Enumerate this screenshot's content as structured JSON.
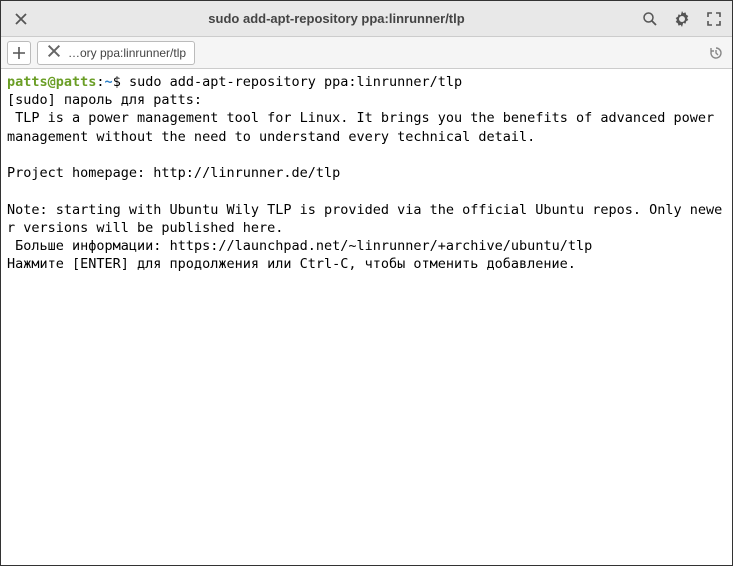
{
  "titlebar": {
    "title": "sudo add-apt-repository ppa:linrunner/tlp"
  },
  "tabbar": {
    "tab_label": "…ory ppa:linrunner/tlp"
  },
  "terminal": {
    "prompt_user": "patts@patts",
    "prompt_sep1": ":",
    "prompt_path": "~",
    "prompt_sep2": "$ ",
    "command": "sudo add-apt-repository ppa:linrunner/tlp",
    "line2": "[sudo] пароль для patts:",
    "line3": " TLP is a power management tool for Linux. It brings you the benefits of advanced power management without the need to understand every technical detail.",
    "line4": "",
    "line5": "Project homepage: http://linrunner.de/tlp",
    "line6": "",
    "line7": "Note: starting with Ubuntu Wily TLP is provided via the official Ubuntu repos. Only newer versions will be published here.",
    "line8": " Больше информации: https://launchpad.net/~linrunner/+archive/ubuntu/tlp",
    "line9": "Нажмите [ENTER] для продолжения или Ctrl-C, чтобы отменить добавление."
  }
}
